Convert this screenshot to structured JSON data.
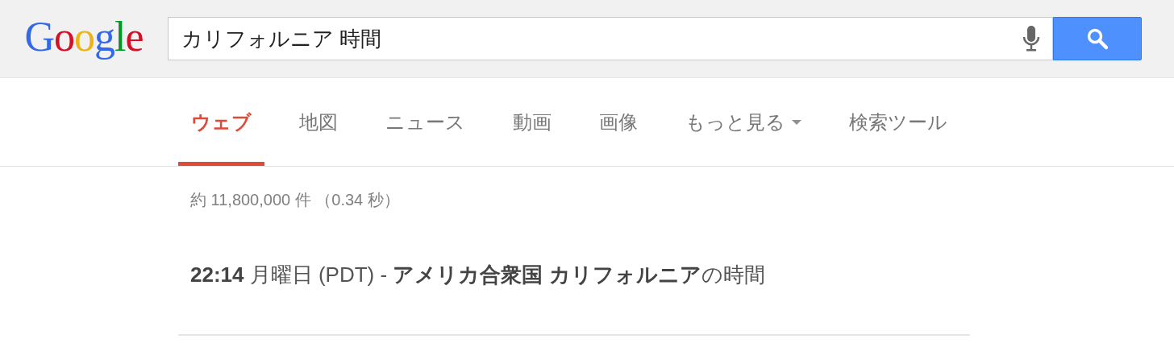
{
  "logo": "Google",
  "search": {
    "value": "カリフォルニア 時間"
  },
  "tabs": [
    {
      "label": "ウェブ",
      "selected": true,
      "kind": "plain"
    },
    {
      "label": "地図",
      "selected": false,
      "kind": "plain"
    },
    {
      "label": "ニュース",
      "selected": false,
      "kind": "plain"
    },
    {
      "label": "動画",
      "selected": false,
      "kind": "plain"
    },
    {
      "label": "画像",
      "selected": false,
      "kind": "plain"
    },
    {
      "label": "もっと見る",
      "selected": false,
      "kind": "dropdown"
    },
    {
      "label": "検索ツール",
      "selected": false,
      "kind": "plain"
    }
  ],
  "result_stats": "約 11,800,000 件 （0.34 秒）",
  "answer": "**22:14** 月曜日 (PDT) - **アメリカ合衆国 カリフォルニア**の時間"
}
